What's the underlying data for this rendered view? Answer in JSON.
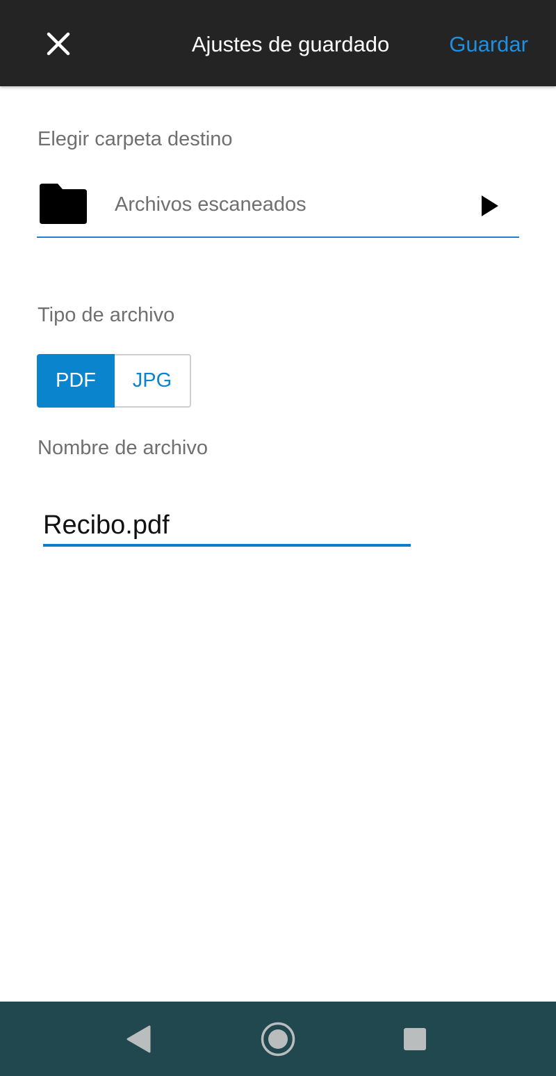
{
  "appbar": {
    "title": "Ajustes de guardado",
    "save_label": "Guardar",
    "close_icon": "close-icon"
  },
  "destination": {
    "label": "Elegir carpeta destino",
    "folder_name": "Archivos escaneados",
    "folder_icon": "folder-icon",
    "arrow_icon": "play-arrow-icon"
  },
  "file_type": {
    "label": "Tipo de archivo",
    "options": [
      "PDF",
      "JPG"
    ],
    "selected": "PDF"
  },
  "file_name": {
    "label": "Nombre de archivo",
    "value": "Recibo.pdf"
  },
  "navbar": {
    "back_icon": "back-triangle-icon",
    "home_icon": "home-circle-icon",
    "recents_icon": "recents-square-icon"
  },
  "colors": {
    "accent": "#0a84cc",
    "appbar_bg": "#242424",
    "navbar_bg": "#21474f",
    "save_text": "#1e90e0"
  }
}
